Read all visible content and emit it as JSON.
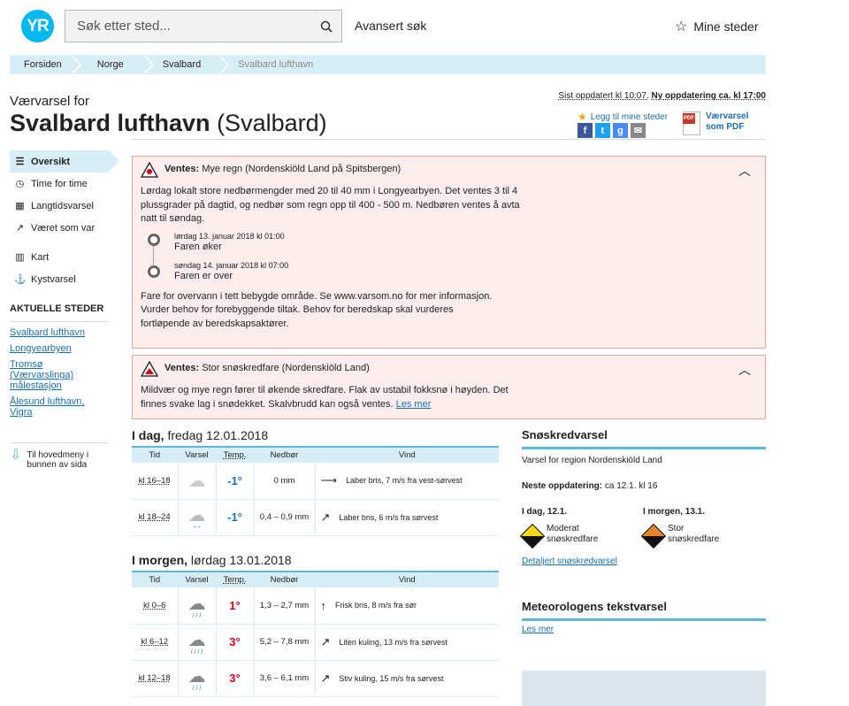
{
  "header": {
    "logo": "YR",
    "search_placeholder": "Søk etter sted...",
    "advanced": "Avansert søk",
    "my_places": "Mine steder"
  },
  "breadcrumb": [
    "Forsiden",
    "Norge",
    "Svalbard",
    "Svalbard lufthavn"
  ],
  "page": {
    "subtitle": "Værvarsel for",
    "title": "Svalbard lufthavn",
    "region": "(Svalbard)",
    "updated": "Sist oppdatert kl 10:07.",
    "next_update": "Ny oppdatering ca. kl 17:00",
    "add_fav": "Legg til mine steder",
    "pdf": "Værvarsel som PDF"
  },
  "nav": [
    {
      "label": "Oversikt",
      "icon": "list-icon"
    },
    {
      "label": "Time for time",
      "icon": "clock-icon"
    },
    {
      "label": "Langtidsvarsel",
      "icon": "calendar-icon"
    },
    {
      "label": "Været som var",
      "icon": "chart-icon"
    },
    {
      "label": "Kart",
      "icon": "map-icon"
    },
    {
      "label": "Kystvarsel",
      "icon": "anchor-icon"
    }
  ],
  "current_places": {
    "heading": "AKTUELLE STEDER",
    "items": [
      "Svalbard lufthavn",
      "Longyearbyen",
      "Tromsø (Værvarslinga) målestasjon",
      "Ålesund lufthavn, Vigra"
    ]
  },
  "back_to_menu": "Til hovedmeny i bunnen av sida",
  "warnings": [
    {
      "label": "Ventes:",
      "title": "Mye regn (Nordenskiöld Land på Spitsbergen)",
      "body": "Lørdag lokalt store nedbørmengder med 20 til 40 mm i Longyearbyen. Det ventes 3 til 4 plussgrader på dagtid, og nedbør som regn opp til 400 - 500 m. Nedbøren ventes å avta natt til søndag.",
      "timeline": [
        {
          "time": "lørdag 13. januar 2018 kl 01:00",
          "event": "Faren øker"
        },
        {
          "time": "søndag 14. januar 2018 kl 07:00",
          "event": "Faren er over"
        }
      ],
      "footer": "Fare for overvann i tett bebygde område. Se www.varsom.no for mer informasjon. Vurder behov for forebyggende tiltak. Behov for beredskap skal vurderes fortløpende av beredskapsaktører."
    },
    {
      "label": "Ventes:",
      "title": "Stor snøskredfare (Nordenskiöld Land)",
      "body": "Mildvær og mye regn fører til økende skredfare. Flak av ustabil fokksnø i høyden. Det finnes svake lag i snødekket. Skalvbrudd kan også ventes.",
      "more": "Les mer"
    }
  ],
  "columns": [
    "Tid",
    "Varsel",
    "Temp.",
    "Nedbør",
    "Vind"
  ],
  "days": [
    {
      "label": "I dag,",
      "date": "fredag 12.01.2018",
      "rows": [
        {
          "time": "kl 16–18",
          "temp": "-1°",
          "precip": "0 mm",
          "wind": "Laber bris, 7 m/s fra vest-sørvest"
        },
        {
          "time": "kl 18–24",
          "temp": "-1°",
          "precip": "0,4 – 0,9 mm",
          "wind": "Laber bris, 6 m/s fra sørvest"
        }
      ]
    },
    {
      "label": "I morgen,",
      "date": "lørdag 13.01.2018",
      "rows": [
        {
          "time": "kl 0–6",
          "temp": "1°",
          "precip": "1,3 – 2,7 mm",
          "wind": "Frisk bris, 8 m/s fra sør"
        },
        {
          "time": "kl 6–12",
          "temp": "3°",
          "precip": "5,2 – 7,8 mm",
          "wind": "Liten kuling, 13 m/s fra sørvest"
        },
        {
          "time": "kl 12–18",
          "temp": "3°",
          "precip": "3,6 – 6,1 mm",
          "wind": "Stiv kuling, 15 m/s fra sørvest"
        }
      ]
    }
  ],
  "avalanche": {
    "heading": "Snøskredvarsel",
    "region": "Varsel for region Nordenskiöld Land",
    "next_label": "Neste oppdatering:",
    "next_value": "ca 12.1. kl 16",
    "today_label": "I dag, 12.1.",
    "today_level": "Moderat snøskredfare",
    "tomorrow_label": "I morgen, 13.1.",
    "tomorrow_level": "Stor snøskredfare",
    "link": "Detaljert snøskredvarsel"
  },
  "meteorologist": {
    "heading": "Meteorologens tekstvarsel",
    "link": "Les mer"
  },
  "colors": {
    "accent": "#00b9f1",
    "warm": "#d0021b",
    "cold": "#1a6fb3"
  }
}
